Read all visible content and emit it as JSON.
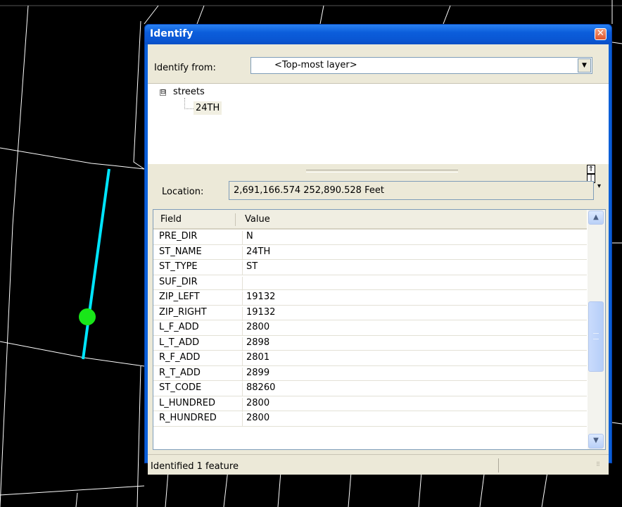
{
  "window": {
    "title": "Identify",
    "close_icon": "close-icon"
  },
  "identify_from": {
    "label": "Identify from:",
    "value": "<Top-most layer>"
  },
  "tree": {
    "layer": "streets",
    "feature": "24TH",
    "toggle_glyph": "⊟"
  },
  "location": {
    "label": "Location:",
    "value": "2,691,166.574  252,890.528 Feet"
  },
  "grid": {
    "headers": {
      "field": "Field",
      "value": "Value"
    },
    "rows": [
      {
        "field": "PRE_DIR",
        "value": "N"
      },
      {
        "field": "ST_NAME",
        "value": "24TH"
      },
      {
        "field": "ST_TYPE",
        "value": "ST"
      },
      {
        "field": "SUF_DIR",
        "value": ""
      },
      {
        "field": "ZIP_LEFT",
        "value": "19132"
      },
      {
        "field": "ZIP_RIGHT",
        "value": "19132"
      },
      {
        "field": "L_F_ADD",
        "value": "2800"
      },
      {
        "field": "L_T_ADD",
        "value": "2898"
      },
      {
        "field": "R_F_ADD",
        "value": "2801"
      },
      {
        "field": "R_T_ADD",
        "value": "2899"
      },
      {
        "field": "ST_CODE",
        "value": "88260"
      },
      {
        "field": "L_HUNDRED",
        "value": "2800"
      },
      {
        "field": "R_HUNDRED",
        "value": "2800"
      }
    ]
  },
  "status": {
    "text": "Identified 1 feature"
  },
  "colors": {
    "map_background": "#000000",
    "street_lines": "#ffffff",
    "selected_street": "#00e5ff",
    "identify_point": "#19e619"
  }
}
